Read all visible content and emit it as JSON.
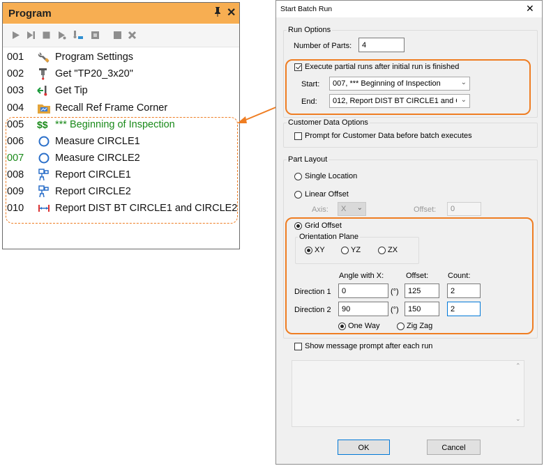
{
  "program": {
    "title": "Program",
    "pin_glyph": "📌",
    "close_glyph": "✕",
    "rows": [
      {
        "num": "001",
        "label": "Program Settings",
        "icon": "wrench-icon"
      },
      {
        "num": "002",
        "label": "Get \"TP20_3x20\"",
        "icon": "probe-icon"
      },
      {
        "num": "003",
        "label": "Get Tip",
        "icon": "get-tip-icon"
      },
      {
        "num": "004",
        "label": "Recall Ref Frame Corner",
        "icon": "ref-frame-icon"
      },
      {
        "num": "005",
        "label": "*** Beginning of Inspection",
        "icon": "comment-dollar-icon",
        "color": "#1a8a1a"
      },
      {
        "num": "006",
        "label": "Measure CIRCLE1",
        "icon": "circle-icon"
      },
      {
        "num": "007",
        "label": "Measure CIRCLE2",
        "icon": "circle-icon",
        "num_color": "#1a8a1a"
      },
      {
        "num": "008",
        "label": "Report CIRCLE1",
        "icon": "report-icon"
      },
      {
        "num": "009",
        "label": "Report CIRCLE2",
        "icon": "report-icon"
      },
      {
        "num": "010",
        "label": "Report DIST BT CIRCLE1 and CIRCLE2",
        "icon": "distance-icon"
      }
    ],
    "dollar_glyph": "$$"
  },
  "dialog": {
    "title": "Start Batch Run",
    "close_glyph": "✕",
    "run_options": {
      "legend": "Run Options",
      "parts_label": "Number of Parts:",
      "parts_value": "4",
      "partial_label": "Execute partial runs after initial run is finished",
      "partial_checked": true,
      "start_label": "Start:",
      "start_value": "007, *** Beginning of Inspection",
      "end_label": "End:",
      "end_value": "012, Report DIST BT CIRCLE1 and C"
    },
    "customer": {
      "legend": "Customer Data Options",
      "prompt_label": "Prompt for Customer Data before batch executes",
      "prompt_checked": false
    },
    "layout": {
      "legend": "Part Layout",
      "single_label": "Single Location",
      "linear_label": "Linear Offset",
      "axis_label": "Axis:",
      "axis_value": "X",
      "offset_label": "Offset:",
      "offset_value": "0",
      "grid_label": "Grid Offset",
      "plane_legend": "Orientation Plane",
      "plane_xy": "XY",
      "plane_yz": "YZ",
      "plane_zx": "ZX",
      "angle_header": "Angle with X:",
      "offset_header": "Offset:",
      "count_header": "Count:",
      "dir1_label": "Direction 1",
      "dir2_label": "Direction 2",
      "deg_unit": "(°)",
      "dir1_angle": "0",
      "dir1_offset": "125",
      "dir1_count": "2",
      "dir2_angle": "90",
      "dir2_offset": "150",
      "dir2_count": "2",
      "one_way_label": "One Way",
      "zigzag_label": "Zig Zag"
    },
    "show_msg_label": "Show message prompt after each run",
    "ok_label": "OK",
    "cancel_label": "Cancel"
  },
  "colors": {
    "accent": "#ef7d22",
    "title_bar": "#f7ae52",
    "comment_green": "#1a8a1a"
  }
}
